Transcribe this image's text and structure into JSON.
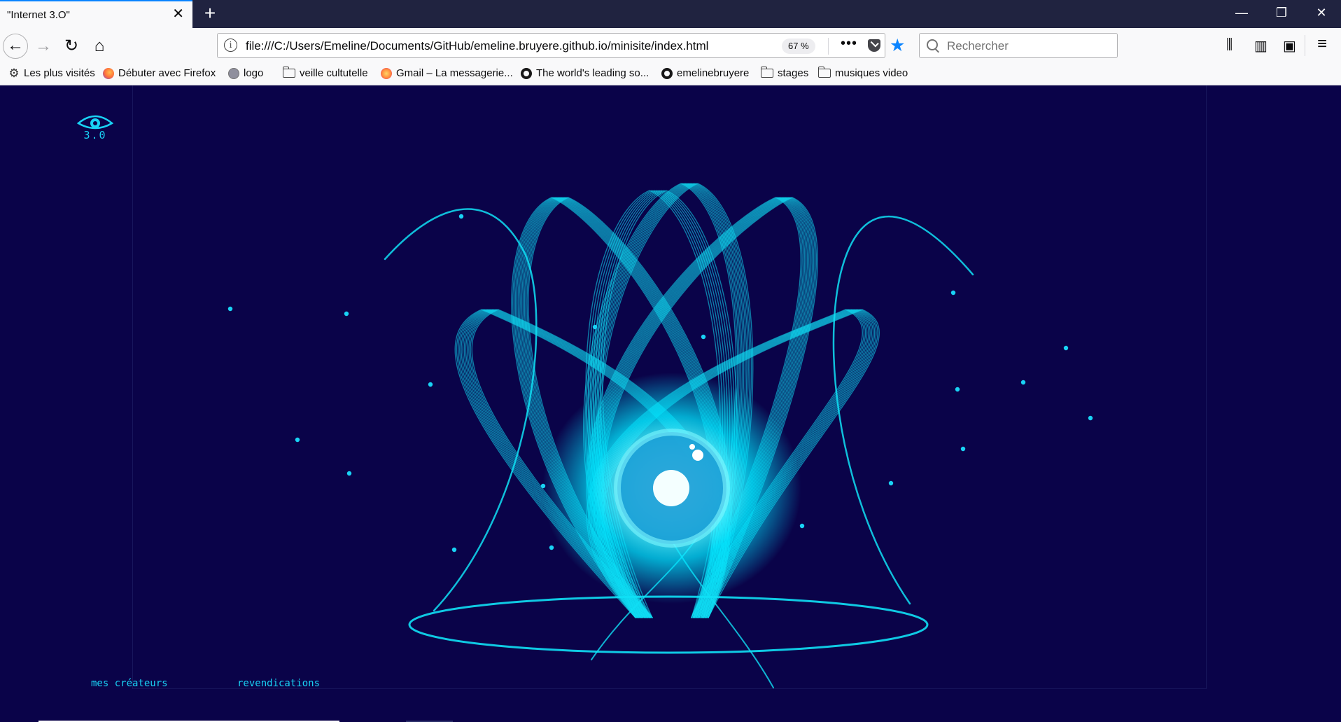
{
  "browser": {
    "tab_title": "\"Internet 3.O\"",
    "tab_close": "✕",
    "new_tab": "+",
    "window": {
      "minimize": "—",
      "restore": "❐",
      "close": "✕"
    },
    "url": "file:///C:/Users/Emeline/Documents/GitHub/emeline.bruyere.github.io/minisite/index.html",
    "zoom": "67 %",
    "page_actions": "•••",
    "search_placeholder": "Rechercher",
    "back_glyph": "←",
    "forward_glyph": "→",
    "reload_glyph": "↻",
    "home_glyph": "⌂",
    "info_glyph": "i",
    "star_glyph": "★",
    "library_glyph": "⫼",
    "sidebar_glyph": "▥",
    "ext_glyph": "▣",
    "menu_glyph": "≡",
    "gear_glyph": "⚙"
  },
  "bookmarks": [
    {
      "label": "Les plus visités",
      "icon": "gear-icon"
    },
    {
      "label": "Débuter avec Firefox",
      "icon": "firefox-icon"
    },
    {
      "label": "logo",
      "icon": "globe-icon"
    },
    {
      "label": "veille cultutelle",
      "icon": "folder-icon"
    },
    {
      "label": "Gmail – La messagerie...",
      "icon": "firefox-icon"
    },
    {
      "label": "The world's leading so...",
      "icon": "github-icon"
    },
    {
      "label": "emelinebruyere",
      "icon": "github-icon"
    },
    {
      "label": "stages",
      "icon": "folder-icon"
    },
    {
      "label": "musiques video",
      "icon": "folder-icon"
    }
  ],
  "page": {
    "logo_text": "3.0",
    "links": {
      "creators": "mes créateurs",
      "claims": "revendications"
    },
    "colors": {
      "background": "#0a0349",
      "accent": "#19d3f5",
      "glow": "#00e5ff"
    }
  }
}
